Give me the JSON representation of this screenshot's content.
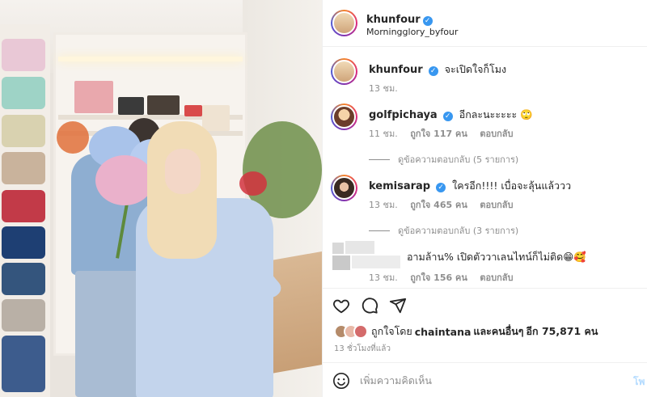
{
  "post": {
    "username": "khunfour",
    "location": "Morningglory_byfour"
  },
  "comments": [
    {
      "username": "khunfour",
      "verified": true,
      "text": "จะเปิดใจก็โมง",
      "time": "13 ชม.",
      "likes": "",
      "reply": ""
    },
    {
      "username": "golfpichaya",
      "verified": true,
      "text": "อีกละนะะะะะ 🙄",
      "time": "11 ชม.",
      "likes": "ถูกใจ 117 คน",
      "reply": "ตอบกลับ",
      "view_replies": "ดูข้อความตอบกลับ (5 รายการ)"
    },
    {
      "username": "kemisarap",
      "verified": true,
      "text": "ใครอีก!!!! เบื่อจะลุ้นแล้ววว",
      "time": "13 ชม.",
      "likes": "ถูกใจ 465 คน",
      "reply": "ตอบกลับ",
      "view_replies": "ดูข้อความตอบกลับ (3 รายการ)"
    },
    {
      "username": "",
      "verified": false,
      "text": "อามล้าน% เปิดตัววาเลนไทน์ก็ไม่ติด😁🥰",
      "time": "13 ชม.",
      "likes": "ถูกใจ 156 คน",
      "reply": "ตอบกลับ"
    }
  ],
  "likes": {
    "prefix": "ถูกใจโดย",
    "user": "chaintana",
    "middle": "และคนอื่นๆ",
    "suffix": "อีก 75,871 คน"
  },
  "timestamp": "13 ชั่วโมงที่แล้ว",
  "composer": {
    "placeholder": "เพิ่มความคิดเห็น",
    "post_label": "โพ"
  },
  "icons": {
    "like": "heart-icon",
    "comment": "comment-icon",
    "share": "send-icon",
    "emoji": "smiley-icon",
    "verified": "verified-badge-icon"
  },
  "colors": {
    "verified": "#3897f0",
    "muted": "#8e8e8e",
    "post_disabled": "#b3dbff"
  }
}
